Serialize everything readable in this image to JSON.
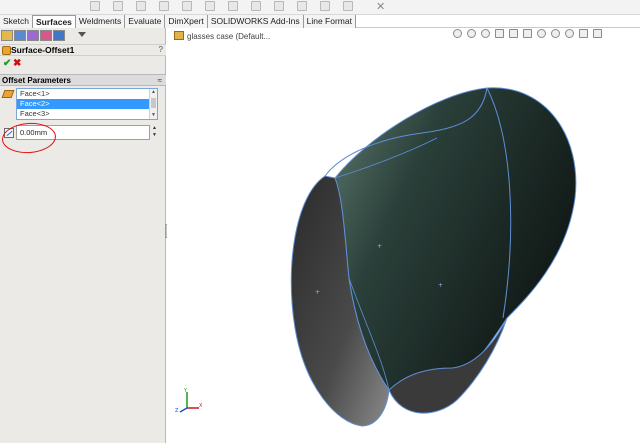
{
  "command_manager": {
    "tabs": [
      {
        "label": "Sketch",
        "active": false
      },
      {
        "label": "Surfaces",
        "active": true
      },
      {
        "label": "Weldments",
        "active": false
      },
      {
        "label": "Evaluate",
        "active": false
      },
      {
        "label": "DimXpert",
        "active": false
      },
      {
        "label": "SOLIDWORKS Add-Ins",
        "active": false
      },
      {
        "label": "Line Format",
        "active": false
      }
    ],
    "close_glyph": "✕"
  },
  "property_manager": {
    "title": "Surface-Offset1",
    "help_glyph": "?",
    "ok_glyph": "✔",
    "cancel_glyph": "✖",
    "group": {
      "title": "Offset Parameters",
      "collapse_glyph": "≈",
      "faces": [
        "Face<1>",
        "Face<2>",
        "Face<3>"
      ],
      "selected_index": 1,
      "offset_value": "0.00mm"
    },
    "colors": {
      "selection": "#3399ff",
      "annotation": "#e01010"
    }
  },
  "graphics_area": {
    "tree_label": "glasses case  (Default...",
    "triad": {
      "x": "X",
      "y": "Y",
      "z": "Z"
    },
    "colors": {
      "model_surface": "#2b403a",
      "model_edge": "#5f8fd8"
    }
  }
}
